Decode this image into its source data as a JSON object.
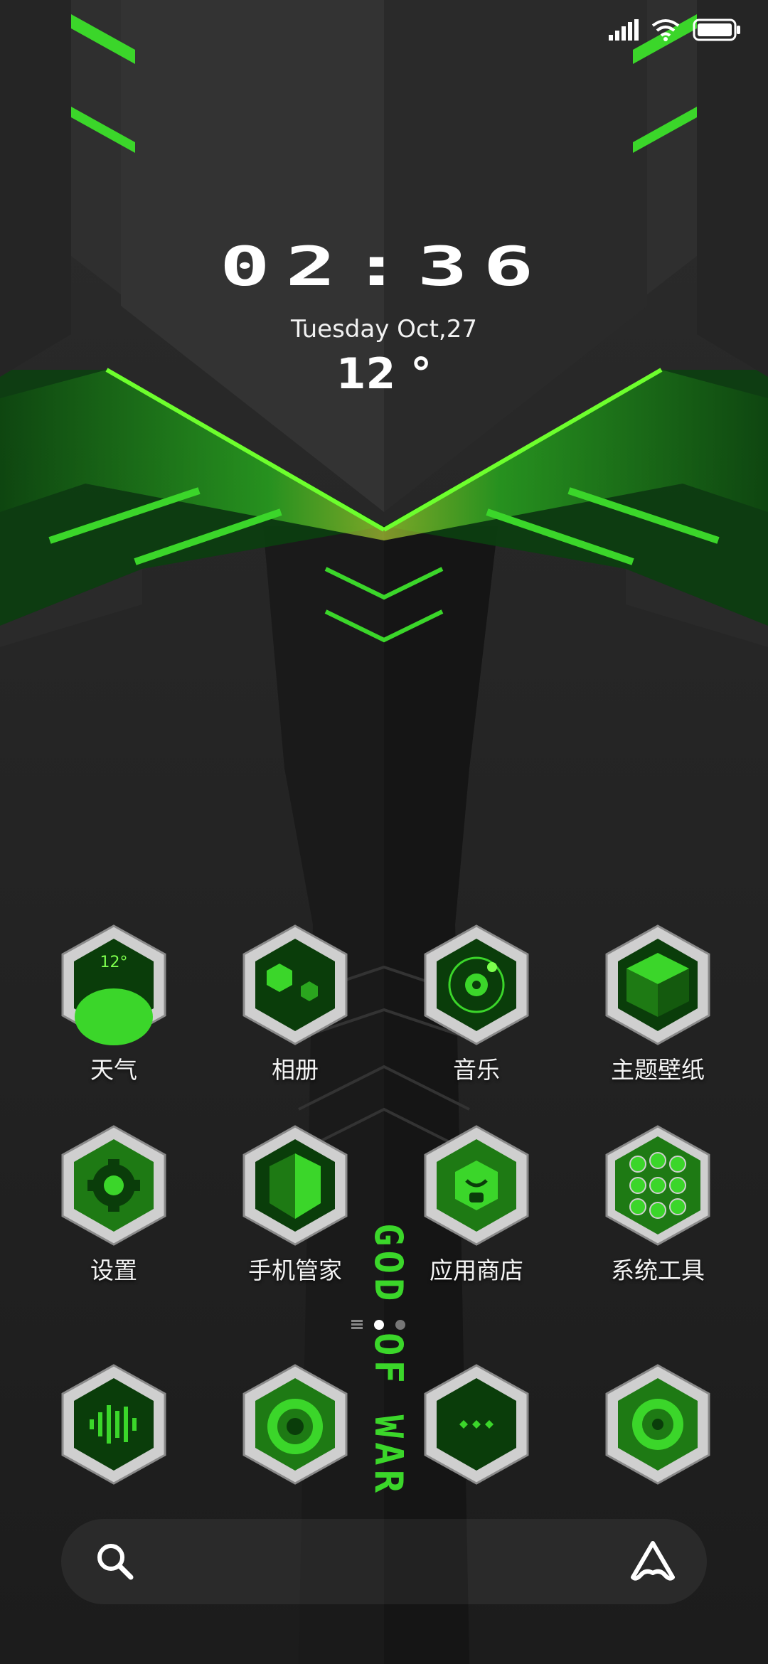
{
  "status_bar": {
    "icons": [
      "signal-icon",
      "wifi-icon",
      "battery-icon"
    ]
  },
  "clock": {
    "time": "02:36",
    "date": "Tuesday Oct,27",
    "temperature": "12 °"
  },
  "apps": [
    {
      "label": "天气",
      "icon": "weather-icon",
      "badge": "12°"
    },
    {
      "label": "相册",
      "icon": "gallery-icon"
    },
    {
      "label": "音乐",
      "icon": "music-icon"
    },
    {
      "label": "主题壁纸",
      "icon": "themes-icon"
    },
    {
      "label": "设置",
      "icon": "settings-icon"
    },
    {
      "label": "手机管家",
      "icon": "security-icon"
    },
    {
      "label": "应用商店",
      "icon": "app-store-icon"
    },
    {
      "label": "系统工具",
      "icon": "tools-folder-icon"
    }
  ],
  "dock_apps": [
    {
      "icon": "voice-recorder-icon"
    },
    {
      "icon": "browser-icon"
    },
    {
      "icon": "messages-icon"
    },
    {
      "icon": "camera-icon"
    }
  ],
  "page_indicator": {
    "total_pages": 2,
    "current_page": 1
  },
  "search_bar": {
    "left_icon": "search-icon",
    "right_icon": "assistant-icon"
  },
  "wallpaper_text": "GOD OF WAR",
  "colors": {
    "accent": "#3bd62a",
    "background": "#222222",
    "metal": "#d0d0d0"
  }
}
